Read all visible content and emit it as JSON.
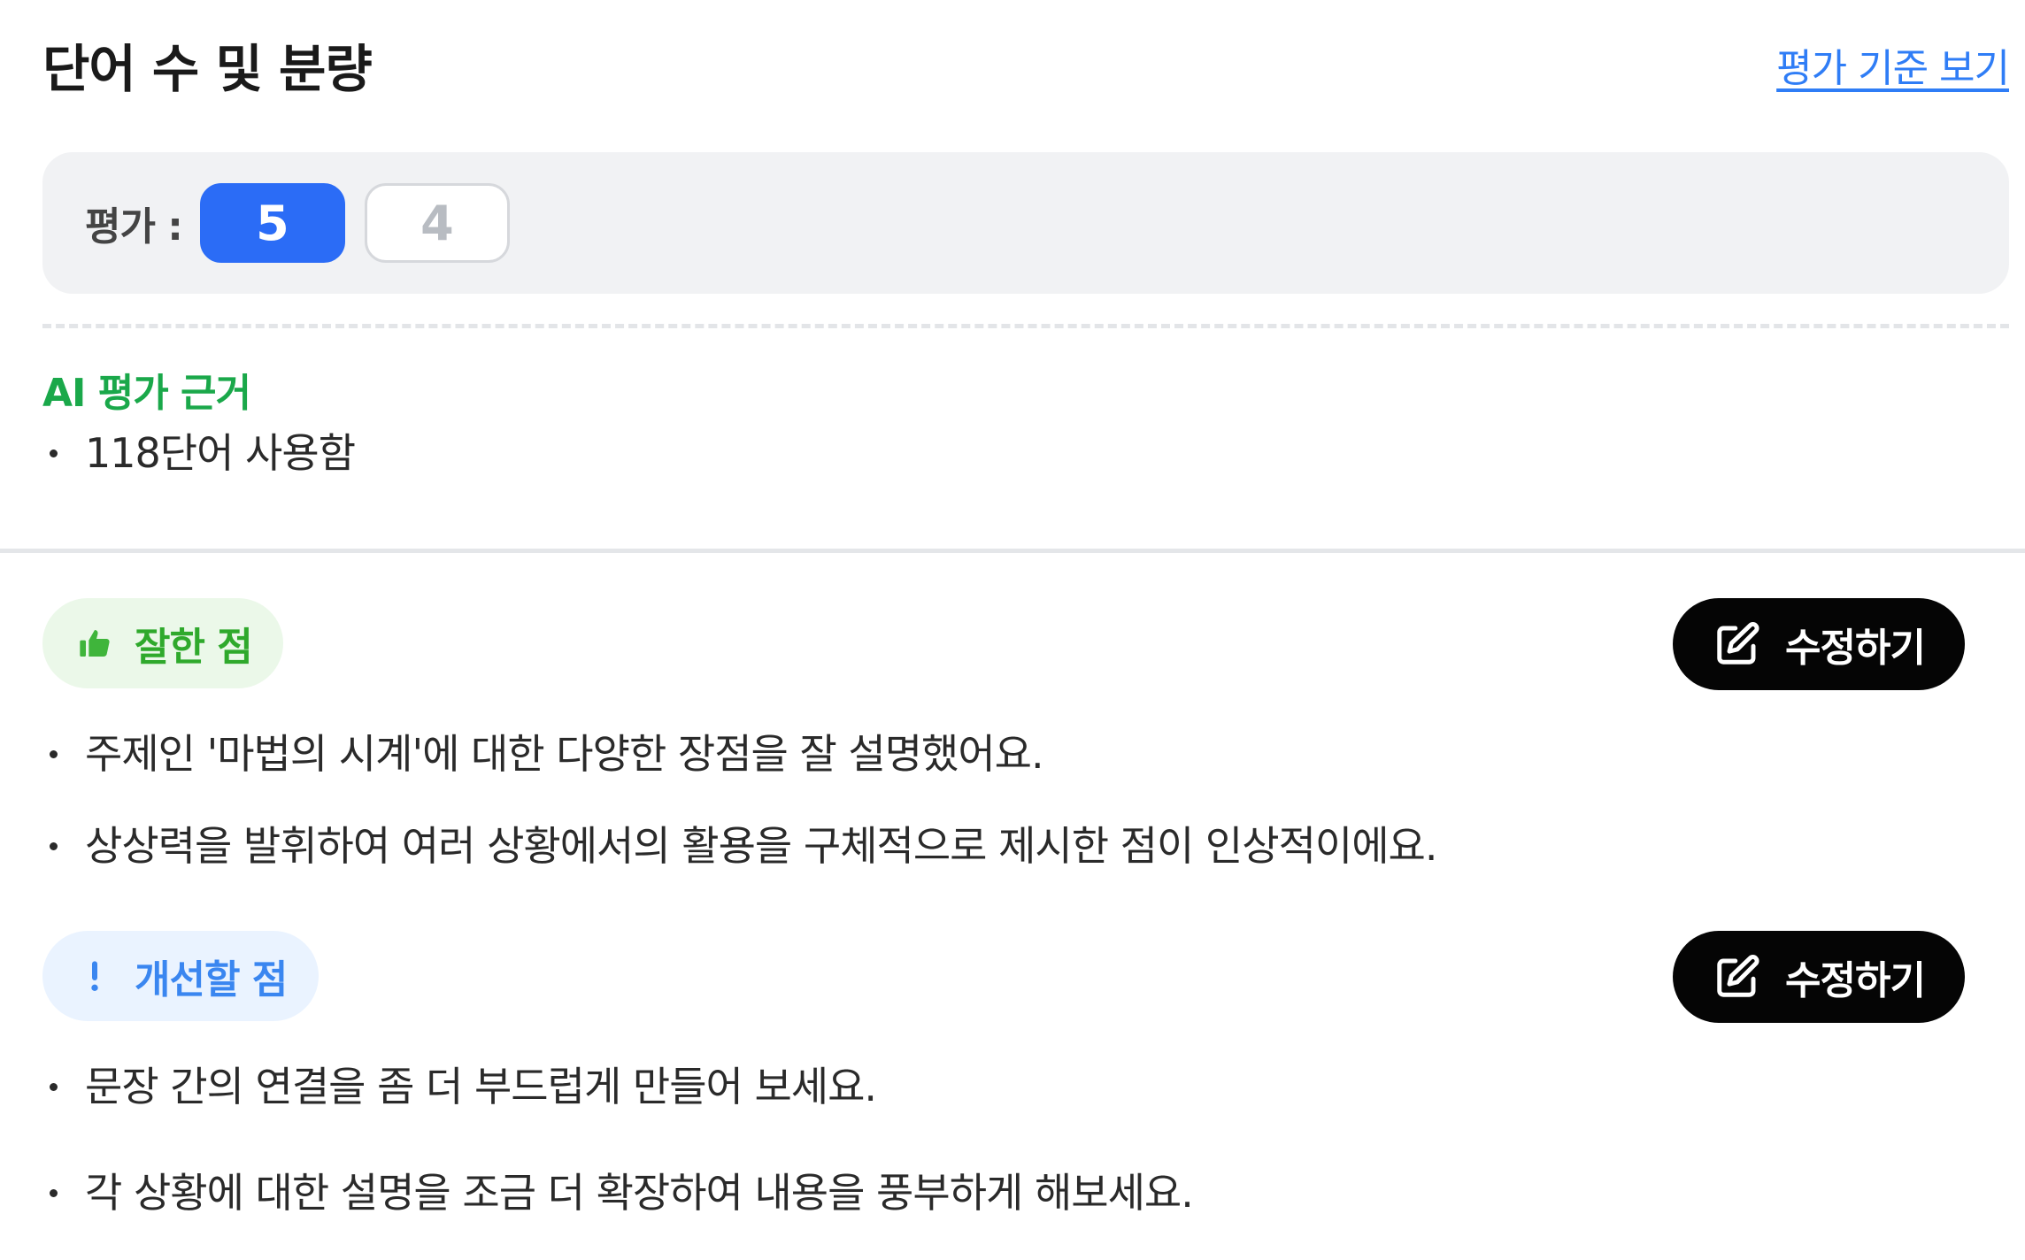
{
  "header": {
    "title": "단어 수 및 분량",
    "criteria_link": "평가 기준 보기"
  },
  "rating": {
    "label": "평가 :",
    "options": [
      {
        "value": "5",
        "selected": true
      },
      {
        "value": "4",
        "selected": false
      }
    ]
  },
  "ai_basis": {
    "title": "AI 평가 근거",
    "items": [
      "118단어 사용함"
    ]
  },
  "strengths": {
    "label": "잘한 점",
    "icon": "thumbs-up-icon",
    "edit_label": "수정하기",
    "items": [
      "주제인 '마법의 시계'에 대한 다양한 장점을 잘 설명했어요.",
      "상상력을 발휘하여 여러 상황에서의 활용을 구체적으로 제시한 점이 인상적이에요."
    ]
  },
  "improvements": {
    "label": "개선할 점",
    "icon": "exclamation-icon",
    "edit_label": "수정하기",
    "items": [
      "문장 간의 연결을 좀 더 부드럽게 만들어 보세요.",
      "각 상황에 대한 설명을 조금 더 확장하여 내용을 풍부하게 해보세요."
    ]
  },
  "colors": {
    "accent_blue": "#2b6cf6",
    "link_blue": "#2f7df6",
    "ai_green": "#1aa84a",
    "good_green": "#2fa92c",
    "improve_blue": "#3a86f0",
    "edit_button_bg": "#050505"
  }
}
